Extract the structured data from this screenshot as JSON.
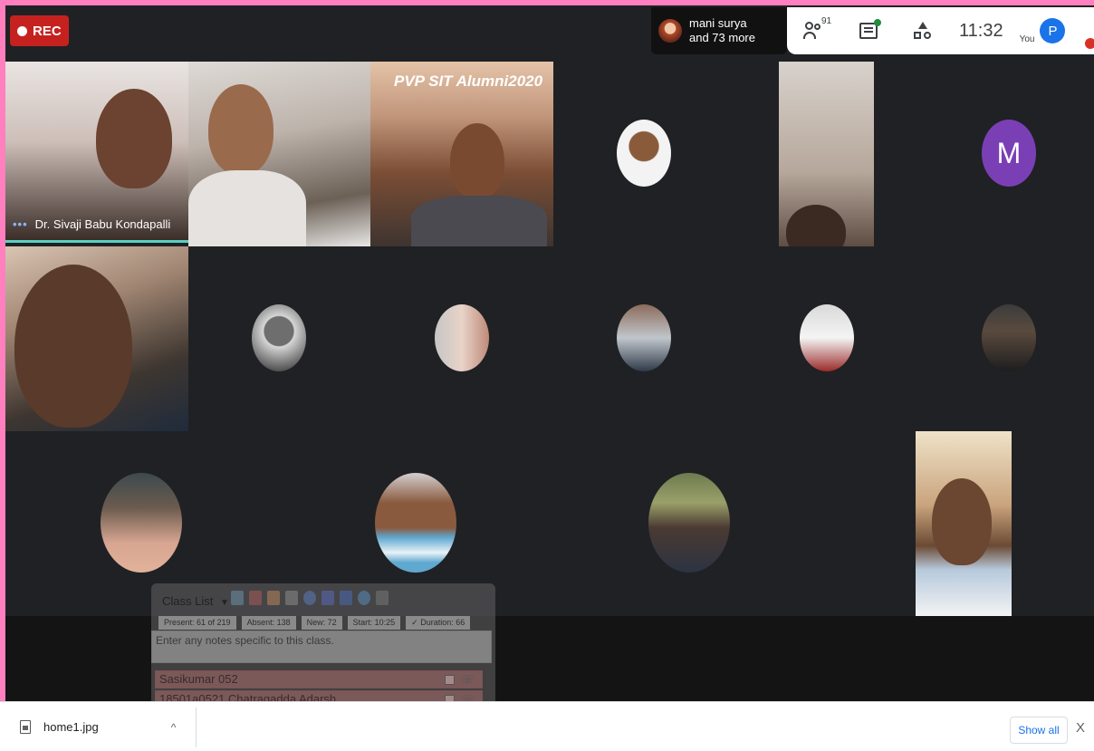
{
  "recording": {
    "label": "REC"
  },
  "joined": {
    "name": "mani surya",
    "more": "and 73 more"
  },
  "toolbar": {
    "participants_count": "91",
    "time": "11:32",
    "you_label": "You",
    "avatar_letter": "P"
  },
  "tiles": {
    "speaker_name": "Dr. Sivaji Babu Kondapalli",
    "banner": "PVP SIT Alumni2020",
    "letter_avatar": "M"
  },
  "class_panel": {
    "title": "Class List",
    "stats": [
      "Present: 61 of 219",
      "Absent: 138",
      "New: 72",
      "Start: 10:25",
      "✓ Duration: 66"
    ],
    "notes_placeholder": "Enter any notes specific to this class.",
    "rows": [
      "Sasikumar 052",
      "18501a0521 Chatragadda Adarsh"
    ]
  },
  "download": {
    "file_name": "home1.jpg",
    "show_all": "Show all",
    "close": "X"
  },
  "colors": {
    "frame": "#ff7fbf",
    "meet_bg": "#202124",
    "rec": "#c5221f",
    "accent": "#1a73e8",
    "avatar_m": "#7b3fb5"
  }
}
